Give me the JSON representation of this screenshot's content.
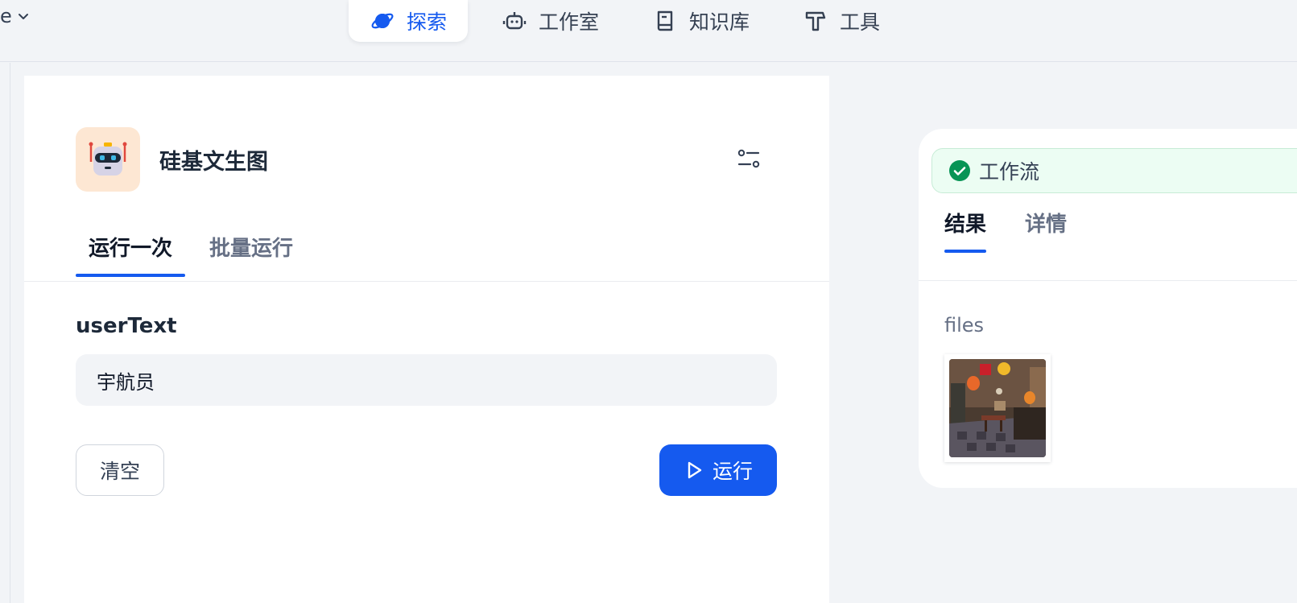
{
  "workspace": {
    "label": "e"
  },
  "nav": {
    "items": [
      {
        "label": "探索",
        "icon": "planet-icon",
        "active": true
      },
      {
        "label": "工作室",
        "icon": "robot-icon",
        "active": false
      },
      {
        "label": "知识库",
        "icon": "book-icon",
        "active": false
      },
      {
        "label": "工具",
        "icon": "hammer-icon",
        "active": false
      }
    ],
    "active_color": "#155aef"
  },
  "app": {
    "title": "硅基文生图",
    "avatar_icon": "robot-avatar-icon",
    "avatar_bg": "#fde7d3"
  },
  "run_tabs": [
    {
      "label": "运行一次",
      "active": true
    },
    {
      "label": "批量运行",
      "active": false
    }
  ],
  "form": {
    "field_label": "userText",
    "field_value": "宇航员",
    "clear_label": "清空",
    "run_label": "运行"
  },
  "result": {
    "status_label": "工作流",
    "status_color": "#079455",
    "tabs": [
      {
        "label": "结果",
        "active": true
      },
      {
        "label": "详情",
        "active": false
      }
    ],
    "files_label": "files"
  },
  "colors": {
    "accent": "#155aef",
    "page_bg": "#f2f4f7",
    "panel_bg": "#ffffff"
  }
}
